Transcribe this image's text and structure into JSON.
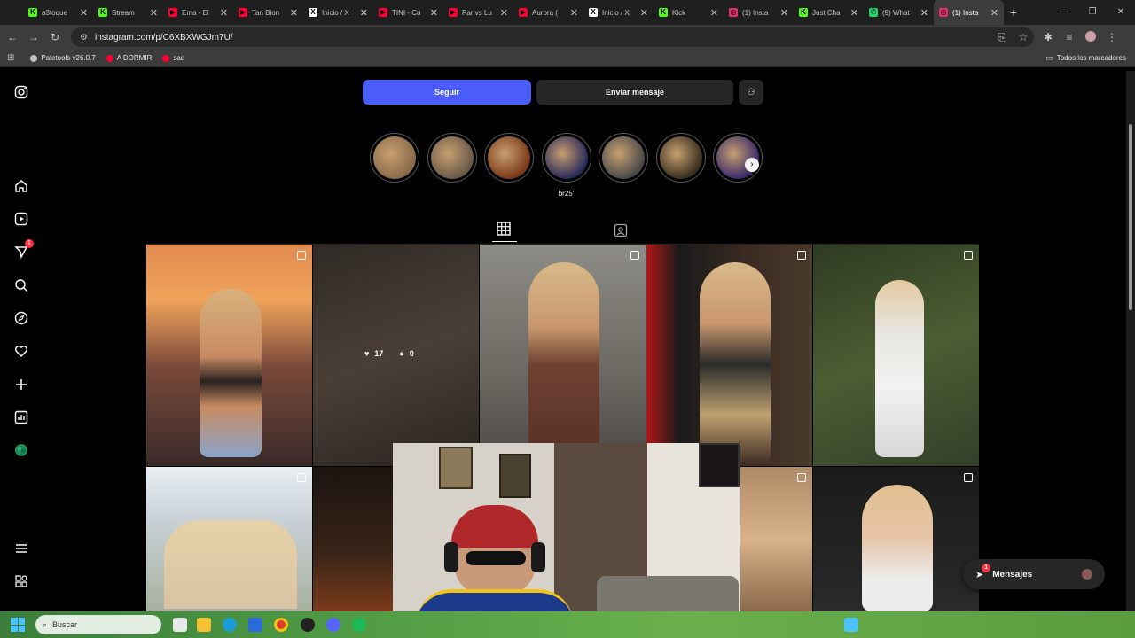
{
  "browser": {
    "tabs": [
      {
        "title": "a3toque",
        "favicon_color": "#53fc18",
        "favicon_letter": "K"
      },
      {
        "title": "Stream",
        "favicon_color": "#53fc18",
        "favicon_letter": "K"
      },
      {
        "title": "Ema - El",
        "favicon_color": "#ff0033",
        "favicon_letter": "▶"
      },
      {
        "title": "Tan Bion",
        "favicon_color": "#ff0033",
        "favicon_letter": "▶"
      },
      {
        "title": "Inicio / X",
        "favicon_color": "#ffffff",
        "favicon_letter": "X"
      },
      {
        "title": "TINI - Cu",
        "favicon_color": "#ff0033",
        "favicon_letter": "▶"
      },
      {
        "title": "Par vs Lu",
        "favicon_color": "#ff0033",
        "favicon_letter": "▶"
      },
      {
        "title": "Aurora (",
        "favicon_color": "#ff0033",
        "favicon_letter": "▶"
      },
      {
        "title": "Inicio / X",
        "favicon_color": "#ffffff",
        "favicon_letter": "X"
      },
      {
        "title": "Kick",
        "favicon_color": "#53fc18",
        "favicon_letter": "K"
      },
      {
        "title": "(1) Insta",
        "favicon_color": "#e1306c",
        "favicon_letter": "◎"
      },
      {
        "title": "Just Cha",
        "favicon_color": "#53fc18",
        "favicon_letter": "K"
      },
      {
        "title": "(9) What",
        "favicon_color": "#25d366",
        "favicon_letter": "✆"
      },
      {
        "title": "(1) Insta",
        "favicon_color": "#e1306c",
        "favicon_letter": "◎",
        "active": true
      }
    ],
    "url": "instagram.com/p/C6XBXWGJm7U/",
    "bookmarks": [
      {
        "label": "Paletools v26.0.7",
        "color": "#c0c0c0"
      },
      {
        "label": "A DORMIR",
        "color": "#ff0033"
      },
      {
        "label": "sad",
        "color": "#ff0033"
      }
    ],
    "all_bookmarks_label": "Todos los marcadores"
  },
  "instagram": {
    "follow_label": "Seguir",
    "message_label": "Enviar mensaje",
    "notification_badge": "1",
    "highlights": [
      {
        "label": "",
        "color": "#8a6a4a"
      },
      {
        "label": "",
        "color": "#6a5a4a"
      },
      {
        "label": "",
        "color": "#7a3a1a"
      },
      {
        "label": "br25'",
        "color": "#2a2a5a"
      },
      {
        "label": "",
        "color": "#4a4a4a"
      },
      {
        "label": "",
        "color": "#3a3020"
      },
      {
        "label": "",
        "color": "#3a2a6a"
      }
    ],
    "hover_post": {
      "likes": "17",
      "comments": "0"
    },
    "messages_label": "Mensajes",
    "messages_badge": "1"
  },
  "taskbar": {
    "search_placeholder": "Buscar"
  }
}
